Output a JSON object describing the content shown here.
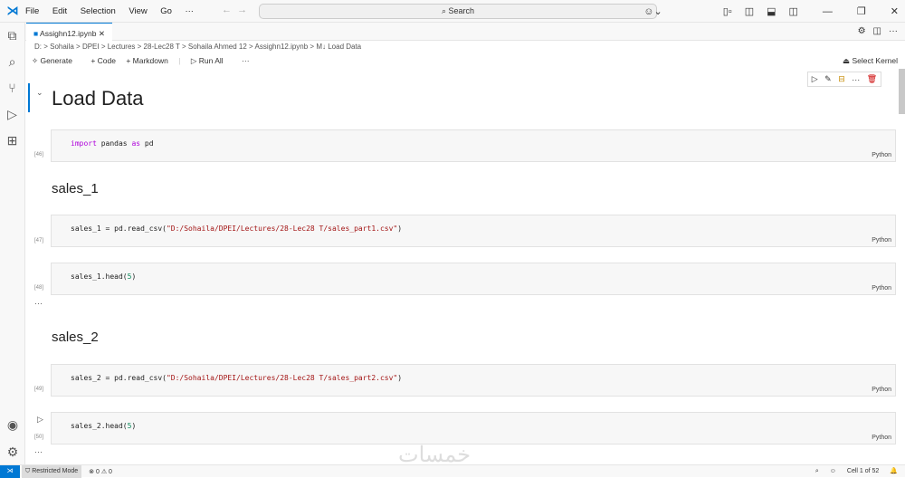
{
  "titlebar": {
    "menu": [
      "File",
      "Edit",
      "Selection",
      "View",
      "Go",
      "···"
    ],
    "search": "Search"
  },
  "tab": {
    "label": "Assighn12.ipynb"
  },
  "breadcrumb": [
    "D:",
    "Sohaila",
    "DPEI",
    "Lectures",
    "28-Lec28 T",
    "Sohaila Ahmed 12",
    "Assighn12.ipynb",
    "M↓ Load Data"
  ],
  "toolbar": {
    "generate": "Generate",
    "code": "+ Code",
    "markdown": "+ Markdown",
    "run_all": "Run All",
    "more": "···",
    "kernel": "Select Kernel"
  },
  "notebook": {
    "title": "Load Data",
    "headings": [
      "sales_1",
      "sales_2"
    ],
    "cells": [
      {
        "count": "[46]",
        "kw1": "import",
        "mid": " pandas ",
        "kw2": "as",
        "end": " pd",
        "lang": "Python"
      },
      {
        "count": "[47]",
        "pre": "sales_1 = pd.read_csv(",
        "str": "\"D:/Sohaila/DPEI/Lectures/28-Lec28 T/sales_part1.csv\"",
        "post": ")",
        "lang": "Python"
      },
      {
        "count": "[48]",
        "pre": "sales_1.head(",
        "num": "5",
        "post": ")",
        "lang": "Python"
      },
      {
        "count": "[49]",
        "pre": "sales_2 = pd.read_csv(",
        "str": "\"D:/Sohaila/DPEI/Lectures/28-Lec28 T/sales_part2.csv\"",
        "post": ")",
        "lang": "Python"
      },
      {
        "count": "[50]",
        "pre": "sales_2.head(",
        "num": "5",
        "post": ")",
        "lang": "Python"
      }
    ],
    "ellipsis": "···"
  },
  "status": {
    "restricted": "Restricted Mode",
    "problems": "⊗ 0 ⚠ 0",
    "cell": "Cell 1 of 52"
  },
  "watermark": "خمسات"
}
